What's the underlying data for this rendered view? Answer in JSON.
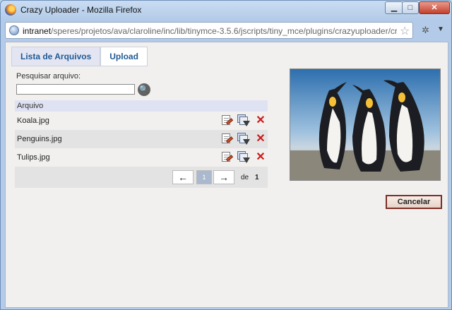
{
  "window": {
    "title": "Crazy Uploader - Mozilla Firefox",
    "url_host": "intranet",
    "url_path": "/speres/projetos/ava/claroline/inc/lib/tinymce-3.5.6/jscripts/tiny_mce/plugins/crazyuploader/crazyuplo",
    "minimize_icon": "minimize-icon",
    "maximize_icon": "maximize-icon",
    "close_label": "✕"
  },
  "tabs": [
    {
      "label": "Lista de Arquivos",
      "active": true
    },
    {
      "label": "Upload",
      "active": false
    }
  ],
  "search": {
    "label": "Pesquisar arquivo:",
    "value": "",
    "placeholder": ""
  },
  "table": {
    "header": "Arquivo",
    "rows": [
      {
        "name": "Koala.jpg"
      },
      {
        "name": "Penguins.jpg"
      },
      {
        "name": "Tulips.jpg"
      }
    ]
  },
  "pager": {
    "prev": "←",
    "current": "1",
    "next": "→",
    "of_label": "de",
    "total": "1"
  },
  "cancel_label": "Cancelar",
  "colors": {
    "tab_text": "#1f5a93",
    "delete": "#cc1a1a",
    "cancel_border": "#7b2e24"
  }
}
